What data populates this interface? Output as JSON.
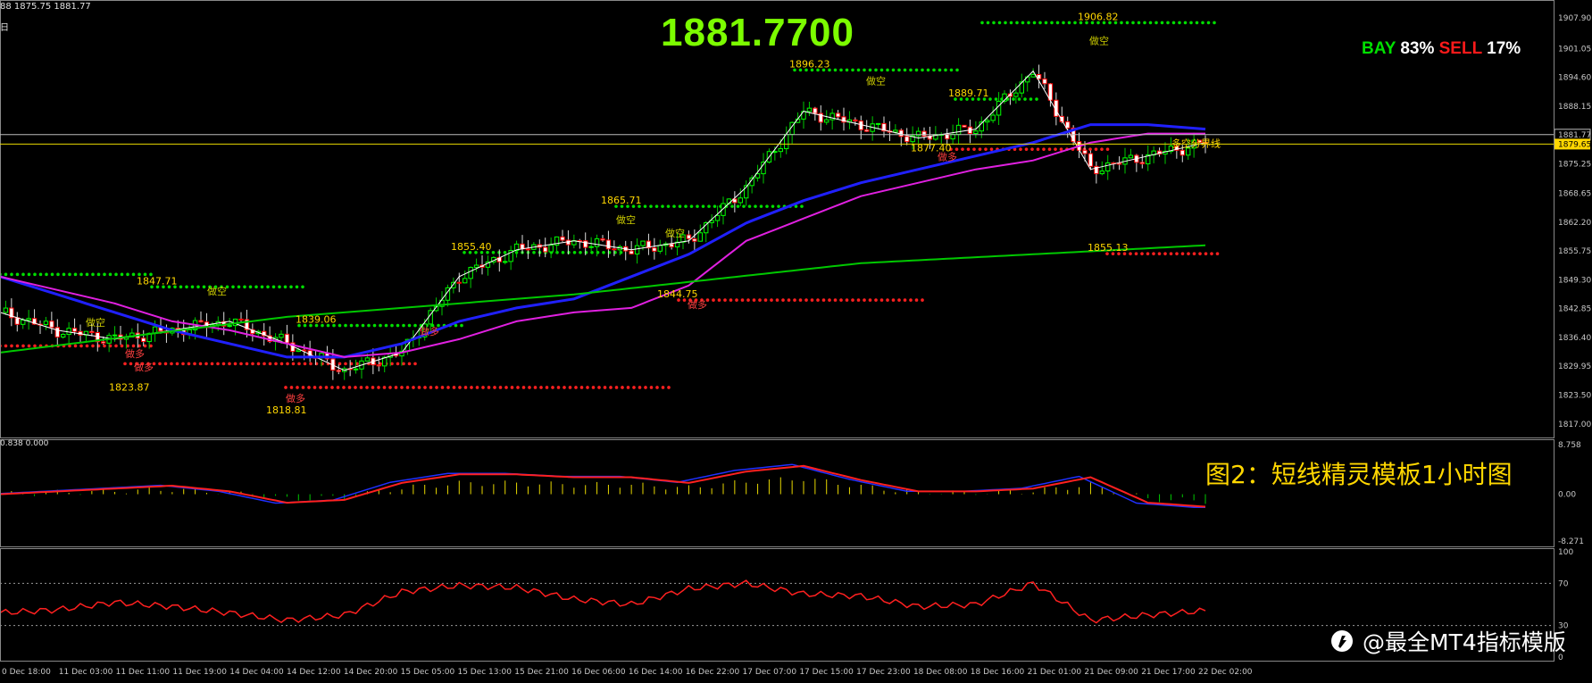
{
  "header": {
    "ohlc": "88 1875.75 1881.77",
    "period_char": "日"
  },
  "big_price": "1881.7700",
  "ratio": {
    "buy_label": "BAY",
    "buy_pct": "83%",
    "sell_label": "SELL",
    "sell_pct": "17%"
  },
  "caption": "图2：短线精灵模板1小时图",
  "indicator_label": "0.838 0.000",
  "watermark": "@最全MT4指标模版",
  "colors": {
    "bull": "#00ff00",
    "bear": "#ff0000",
    "ma_blue": "#2020ff",
    "ma_magenta": "#e020e0",
    "ma_green": "#00c800",
    "dots_green": "#00dd00",
    "dots_red": "#ff2020",
    "label_yellow": "#ffd700",
    "grid_text": "#c8c8c8"
  },
  "chart_data": [
    {
      "type": "candlestick",
      "title": "",
      "y_axis_ticks": [
        "1907.90",
        "1901.05",
        "1894.60",
        "1888.15",
        "1881.77",
        "1879.65",
        "1875.25",
        "1868.65",
        "1862.20",
        "1855.75",
        "1849.30",
        "1842.85",
        "1836.40",
        "1829.95",
        "1823.50",
        "1817.00"
      ],
      "ylim": [
        1817.0,
        1907.9
      ],
      "x_axis_ticks": [
        "0 Dec 18:00",
        "11 Dec 03:00",
        "11 Dec 11:00",
        "11 Dec 19:00",
        "14 Dec 04:00",
        "14 Dec 12:00",
        "14 Dec 20:00",
        "15 Dec 05:00",
        "15 Dec 13:00",
        "15 Dec 21:00",
        "16 Dec 06:00",
        "16 Dec 14:00",
        "16 Dec 22:00",
        "17 Dec 07:00",
        "17 Dec 15:00",
        "17 Dec 23:00",
        "18 Dec 08:00",
        "18 Dec 16:00",
        "21 Dec 01:00",
        "21 Dec 09:00",
        "21 Dec 17:00",
        "22 Dec 02:00"
      ],
      "current_price": 1881.77,
      "bull_bear_line": 1879.65,
      "price_labels": [
        "1906.82",
        "1896.23",
        "1889.71",
        "1877.40",
        "1865.71",
        "1855.40",
        "1847.71",
        "1839.06",
        "1844.75",
        "1823.87",
        "1818.81",
        "1855.13"
      ],
      "annotations": [
        "做空",
        "做空",
        "做空",
        "做空",
        "做空",
        "做空",
        "做多",
        "做多",
        "做多",
        "做多",
        "做多",
        "做多",
        "多空分界线"
      ],
      "series": [
        {
          "name": "",
          "x": [
            0,
            10,
            20,
            30,
            40,
            50,
            60,
            70,
            80,
            90,
            100,
            110,
            120,
            130,
            140,
            150,
            160,
            170,
            180,
            190,
            200,
            210
          ],
          "values": [
            1842,
            1838,
            1836,
            1838,
            1840,
            1835,
            1829,
            1833,
            1850,
            1856,
            1858,
            1856,
            1858,
            1870,
            1887,
            1884,
            1881,
            1883,
            1896,
            1874,
            1877,
            1880
          ]
        },
        {
          "name": "",
          "x": [
            0,
            10,
            20,
            30,
            40,
            50,
            60,
            70,
            80,
            90,
            100,
            110,
            120,
            130,
            140,
            150,
            160,
            170,
            180,
            190,
            200,
            210
          ],
          "values": [
            1850,
            1846,
            1842,
            1838,
            1835,
            1832,
            1832,
            1835,
            1840,
            1843,
            1845,
            1850,
            1855,
            1862,
            1867,
            1871,
            1874,
            1877,
            1880,
            1884,
            1884,
            1883
          ]
        },
        {
          "name": "",
          "x": [
            0,
            10,
            20,
            30,
            40,
            50,
            60,
            70,
            80,
            90,
            100,
            110,
            120,
            130,
            140,
            150,
            160,
            170,
            180,
            190,
            200,
            210
          ],
          "values": [
            1850,
            1847,
            1844,
            1840,
            1838,
            1835,
            1832,
            1833,
            1836,
            1840,
            1842,
            1843,
            1848,
            1858,
            1863,
            1868,
            1871,
            1874,
            1876,
            1880,
            1882,
            1882
          ]
        },
        {
          "name": "",
          "x": [
            0,
            50,
            100,
            150,
            210
          ],
          "values": [
            1833,
            1841,
            1846,
            1853,
            1857
          ]
        }
      ]
    },
    {
      "type": "line",
      "title": "",
      "y_axis_ticks": [
        "8.758",
        "0.00",
        "-8.271"
      ],
      "ylim": [
        -8.271,
        8.758
      ],
      "series": [
        {
          "name": "",
          "x": [
            0,
            10,
            20,
            30,
            40,
            50,
            60,
            70,
            80,
            90,
            100,
            110,
            120,
            130,
            140,
            150,
            160,
            170,
            180,
            190,
            200,
            210
          ],
          "values": [
            0,
            0.5,
            1,
            1.5,
            0.5,
            -1.5,
            -1,
            2,
            3.5,
            3.5,
            3,
            3,
            2,
            4,
            5,
            2.5,
            0.5,
            0.5,
            1,
            3,
            -1.5,
            -2.2
          ]
        }
      ]
    },
    {
      "type": "line",
      "title": "",
      "y_axis_ticks": [
        "100",
        "70",
        "30",
        "0"
      ],
      "ylim": [
        0,
        100
      ],
      "levels": [
        70,
        30
      ],
      "series": [
        {
          "name": "",
          "x": [
            0,
            10,
            20,
            30,
            40,
            50,
            60,
            70,
            80,
            90,
            100,
            110,
            120,
            130,
            140,
            150,
            160,
            170,
            180,
            190,
            200,
            210
          ],
          "values": [
            42,
            45,
            52,
            48,
            42,
            35,
            40,
            62,
            68,
            66,
            55,
            50,
            65,
            70,
            60,
            58,
            48,
            50,
            70,
            35,
            40,
            44
          ]
        }
      ]
    }
  ]
}
